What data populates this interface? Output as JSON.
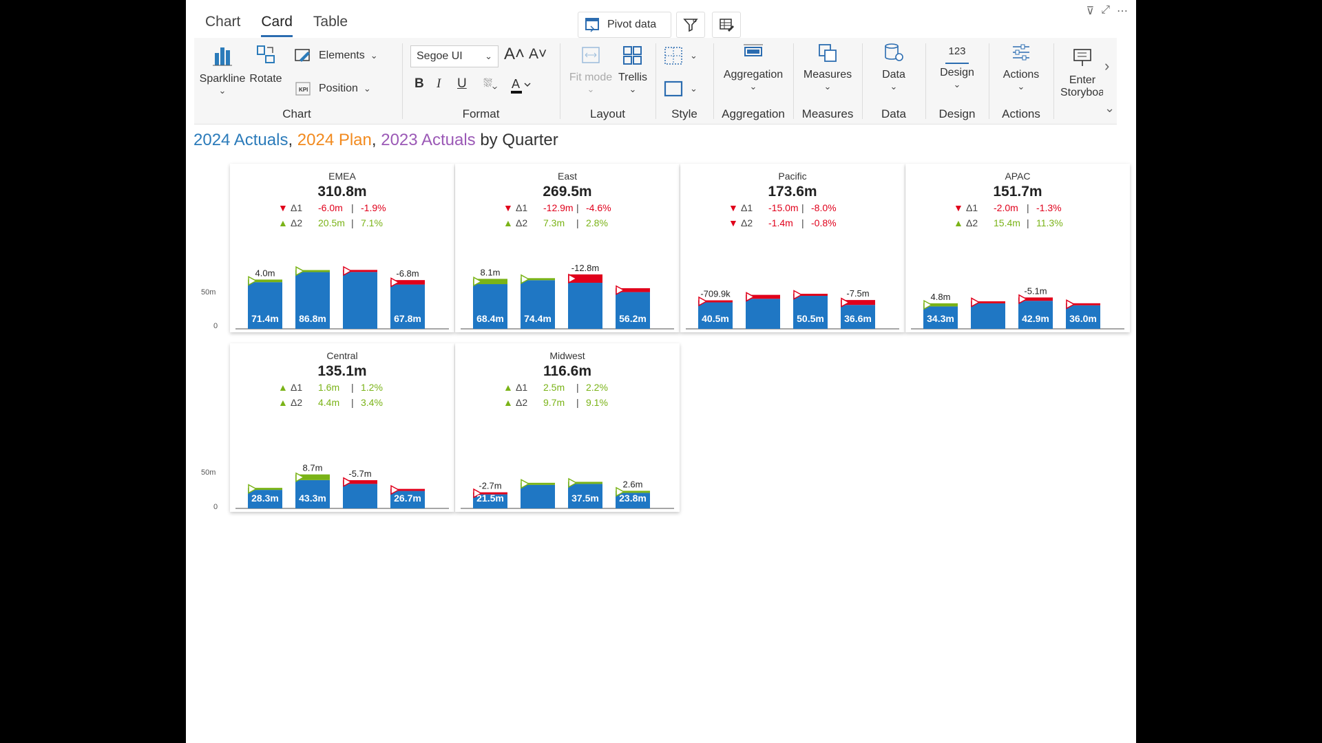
{
  "tabs": [
    {
      "label": "Chart"
    },
    {
      "label": "Card"
    },
    {
      "label": "Table"
    }
  ],
  "top_buttons": {
    "pivot": "Pivot data"
  },
  "ribbon": {
    "chart": {
      "label": "Chart",
      "sparkline": "Sparkline",
      "rotate": "Rotate",
      "elements": "Elements",
      "position": "Position"
    },
    "format": {
      "label": "Format",
      "font": "Segoe UI",
      "bold": "B",
      "italic": "I",
      "underline": "U"
    },
    "layout": {
      "label": "Layout",
      "fitmode": "Fit mode",
      "trellis": "Trellis"
    },
    "style": {
      "label": "Style"
    },
    "aggregation": {
      "label": "Aggregation",
      "button": "Aggregation"
    },
    "measures": {
      "label": "Measures",
      "button": "Measures"
    },
    "data": {
      "label": "Data",
      "button": "Data"
    },
    "design": {
      "label": "Design",
      "button": "Design",
      "icon_text": "123"
    },
    "actions": {
      "label": "Actions",
      "button": "Actions"
    },
    "storyboard": {
      "line1": "Enter",
      "line2": "Storyboa"
    }
  },
  "title": {
    "part1": "2024 Actuals",
    "sep1": ",",
    "part2": "2024 Plan",
    "sep2": ",",
    "part3": "2023 Actuals",
    "rest": "by Quarter",
    "color1": "#2b7bba",
    "color2": "#f28a1e",
    "color3": "#9b59b6"
  },
  "axis": {
    "tick50": "50m",
    "tick0": "0"
  },
  "colors": {
    "bar": "#1f77c4",
    "pos": "#7ab317",
    "neg": "#e0001b"
  },
  "cards": [
    {
      "region": "EMEA",
      "total": "310.8m",
      "d1": {
        "dir": "down",
        "label": "Δ1",
        "abs": "-6.0m",
        "pct": "-1.9%"
      },
      "d2": {
        "dir": "up",
        "label": "Δ2",
        "abs": "20.5m",
        "pct": "7.1%"
      },
      "bars": [
        {
          "v": 71.4,
          "label": "71.4m",
          "var": 4.0,
          "varlabel": "4.0m"
        },
        {
          "v": 86.8,
          "label": "86.8m",
          "var": 2,
          "varlabel": ""
        },
        {
          "v": 87,
          "label": "",
          "var": -1,
          "varlabel": ""
        },
        {
          "v": 67.8,
          "label": "67.8m",
          "var": -6.8,
          "varlabel": "-6.8m"
        }
      ]
    },
    {
      "region": "East",
      "total": "269.5m",
      "d1": {
        "dir": "down",
        "label": "Δ1",
        "abs": "-12.9m",
        "pct": "-4.6%"
      },
      "d2": {
        "dir": "up",
        "label": "Δ2",
        "abs": "7.3m",
        "pct": "2.8%"
      },
      "bars": [
        {
          "v": 68.4,
          "label": "68.4m",
          "var": 8.1,
          "varlabel": "8.1m"
        },
        {
          "v": 74.4,
          "label": "74.4m",
          "var": 1,
          "varlabel": ""
        },
        {
          "v": 70.5,
          "label": "",
          "var": -12.8,
          "varlabel": "-12.8m"
        },
        {
          "v": 56.2,
          "label": "56.2m",
          "var": -6,
          "varlabel": ""
        }
      ]
    },
    {
      "region": "Pacific",
      "total": "173.6m",
      "d1": {
        "dir": "down",
        "label": "Δ1",
        "abs": "-15.0m",
        "pct": "-8.0%"
      },
      "d2": {
        "dir": "down",
        "label": "Δ2",
        "abs": "-1.4m",
        "pct": "-0.8%"
      },
      "bars": [
        {
          "v": 40.5,
          "label": "40.5m",
          "var": -0.7,
          "varlabel": "-709.9k"
        },
        {
          "v": 46,
          "label": "",
          "var": -6,
          "varlabel": ""
        },
        {
          "v": 50.5,
          "label": "50.5m",
          "var": -2,
          "varlabel": ""
        },
        {
          "v": 36.6,
          "label": "36.6m",
          "var": -7.5,
          "varlabel": "-7.5m"
        }
      ]
    },
    {
      "region": "APAC",
      "total": "151.7m",
      "d1": {
        "dir": "down",
        "label": "Δ1",
        "abs": "-2.0m",
        "pct": "-1.3%"
      },
      "d2": {
        "dir": "up",
        "label": "Δ2",
        "abs": "15.4m",
        "pct": "11.3%"
      },
      "bars": [
        {
          "v": 34.3,
          "label": "34.3m",
          "var": 4.8,
          "varlabel": "4.8m"
        },
        {
          "v": 39,
          "label": "",
          "var": -1,
          "varlabel": ""
        },
        {
          "v": 42.9,
          "label": "42.9m",
          "var": -5.1,
          "varlabel": "-5.1m"
        },
        {
          "v": 36.0,
          "label": "36.0m",
          "var": -1.5,
          "varlabel": ""
        }
      ]
    },
    {
      "region": "Central",
      "total": "135.1m",
      "d1": {
        "dir": "up",
        "label": "Δ1",
        "abs": "1.6m",
        "pct": "1.2%"
      },
      "d2": {
        "dir": "up",
        "label": "Δ2",
        "abs": "4.4m",
        "pct": "3.4%"
      },
      "bars": [
        {
          "v": 28.3,
          "label": "28.3m",
          "var": 2,
          "varlabel": ""
        },
        {
          "v": 43.3,
          "label": "43.3m",
          "var": 8.7,
          "varlabel": "8.7m"
        },
        {
          "v": 37.5,
          "label": "",
          "var": -5.7,
          "varlabel": "-5.7m"
        },
        {
          "v": 26.7,
          "label": "26.7m",
          "var": -3,
          "varlabel": ""
        }
      ]
    },
    {
      "region": "Midwest",
      "total": "116.6m",
      "d1": {
        "dir": "up",
        "label": "Δ1",
        "abs": "2.5m",
        "pct": "2.2%"
      },
      "d2": {
        "dir": "up",
        "label": "Δ2",
        "abs": "9.7m",
        "pct": "9.1%"
      },
      "bars": [
        {
          "v": 21.5,
          "label": "21.5m",
          "var": -2.7,
          "varlabel": "-2.7m"
        },
        {
          "v": 36,
          "label": "",
          "var": 1,
          "varlabel": ""
        },
        {
          "v": 37.5,
          "label": "37.5m",
          "var": 2,
          "varlabel": ""
        },
        {
          "v": 23.8,
          "label": "23.8m",
          "var": 2.6,
          "varlabel": "2.6m"
        }
      ]
    }
  ]
}
